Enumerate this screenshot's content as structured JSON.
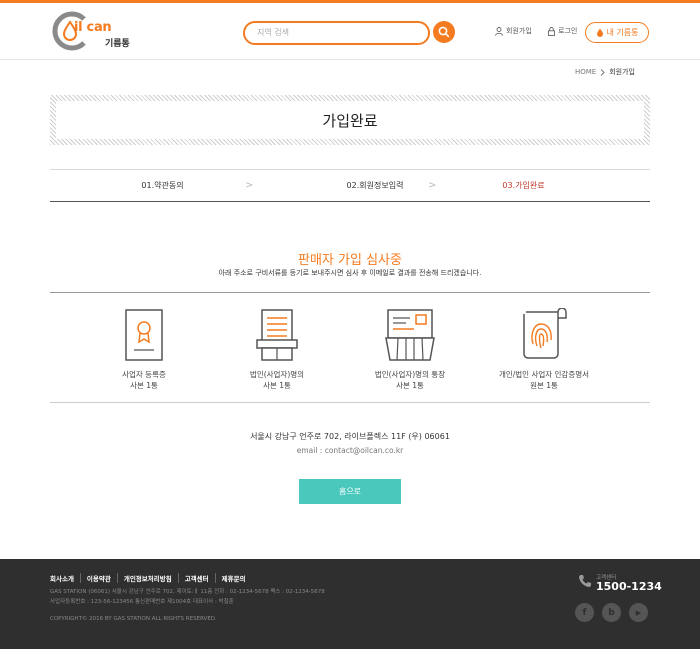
{
  "header": {
    "logo_name": "il can",
    "logo_sub": "기름통",
    "search_placeholder": "지역 검색",
    "signup_label": "회원가입",
    "login_label": "로그인",
    "my_box_label": "내 기름통"
  },
  "breadcrumb": {
    "home": "HOME",
    "current": "회원가입"
  },
  "page_title": "가입완료",
  "steps": [
    {
      "label": "01.약관동의"
    },
    {
      "label": "02.회원정보입력"
    },
    {
      "label": "03.가입완료"
    }
  ],
  "status": {
    "heading": "판매자 가입 심사중",
    "message": "아래 주소로 구비서류를 등기로 보내주시면 심사 후 이메일로 결과를 전송해 드리겠습니다."
  },
  "documents": [
    {
      "caption": "사업자 등록증\n사본 1통",
      "icon": "certificate-icon"
    },
    {
      "caption": "법인(사업자)명의\n사본 1통",
      "icon": "document-icon"
    },
    {
      "caption": "법인(사업자)명의 통장\n사본 1통",
      "icon": "bankbook-icon"
    },
    {
      "caption": "개인/법인 사업자 인감증명서\n원본 1통",
      "icon": "fingerprint-icon"
    }
  ],
  "contact": {
    "address": "서울시 강남구 언주로 702, 라이브플렉스 11F (우) 06061",
    "email": "email : contact@oilcan.co.kr"
  },
  "home_button": "홈으로",
  "footer": {
    "nav": [
      "회사소개",
      "이용약관",
      "개인정보처리방침",
      "고객센터",
      "제휴문의"
    ],
    "info_line1": "GAS STATION (06061) 서울시 강남구 언주로 702, 제이토:ㅐ 11층   전화 : 02-1234-5678   팩스 : 02-1234-5678",
    "info_line2": "사업자등록번호 : 123-56-123456   통신판매번호 제1004호   대표이사 : 박철훈",
    "copyright": "COPYRIGHT© 2016 BY GAS STATION ALL RIGHTS RESERVED.",
    "cs_label": "고객센터",
    "cs_phone": "1500-1234",
    "social": [
      "f",
      "b",
      "▶"
    ]
  },
  "colors": {
    "accent": "#f47b20",
    "teal": "#4bc8bc",
    "active_step": "#c0392b",
    "footer_bg": "#2f2f2f"
  }
}
